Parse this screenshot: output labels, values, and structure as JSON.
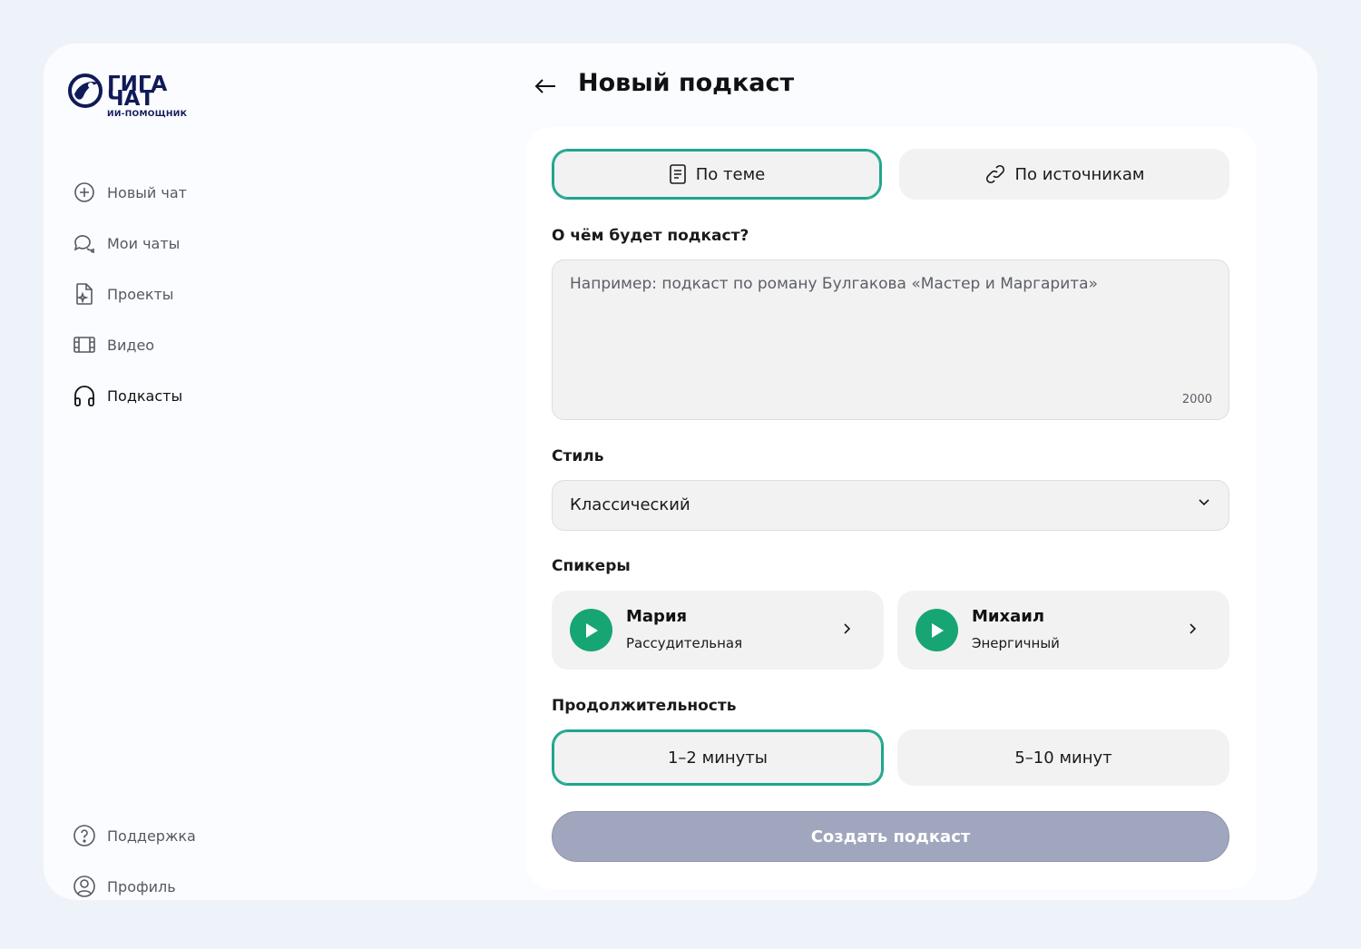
{
  "logo": {
    "line1": "ГИГА",
    "line2": "ЧАТ",
    "sub": "ИИ-ПОМОЩНИК"
  },
  "sidebar": {
    "items": [
      {
        "label": "Новый чат",
        "icon": "plus-circle-icon"
      },
      {
        "label": "Мои чаты",
        "icon": "chat-bubbles-icon"
      },
      {
        "label": "Проекты",
        "icon": "document-sparkle-icon"
      },
      {
        "label": "Видео",
        "icon": "film-icon"
      },
      {
        "label": "Подкасты",
        "icon": "headphones-icon",
        "active": true
      }
    ],
    "bottom": [
      {
        "label": "Поддержка",
        "icon": "help-circle-icon"
      },
      {
        "label": "Профиль",
        "icon": "user-circle-icon"
      }
    ]
  },
  "header": {
    "title": "Новый подкаст"
  },
  "mode": {
    "by_topic": "По теме",
    "by_sources": "По источникам",
    "selected": "by_topic"
  },
  "topic": {
    "label": "О чём будет подкаст?",
    "placeholder": "Например: подкаст по роману Булгакова «Мастер и Маргарита»",
    "limit": "2000"
  },
  "style": {
    "label": "Стиль",
    "value": "Классический"
  },
  "speakers": {
    "label": "Спикеры",
    "items": [
      {
        "name": "Мария",
        "desc": "Рассудительная"
      },
      {
        "name": "Михаил",
        "desc": "Энергичный"
      }
    ]
  },
  "duration": {
    "label": "Продолжительность",
    "options": [
      "1–2 минуты",
      "5–10 минут"
    ],
    "selected": 0
  },
  "submit_label": "Создать подкаст",
  "colors": {
    "accent": "#1fa58c",
    "play": "#17a574",
    "submit_disabled": "#a0a6bd",
    "brand": "#101a57"
  }
}
